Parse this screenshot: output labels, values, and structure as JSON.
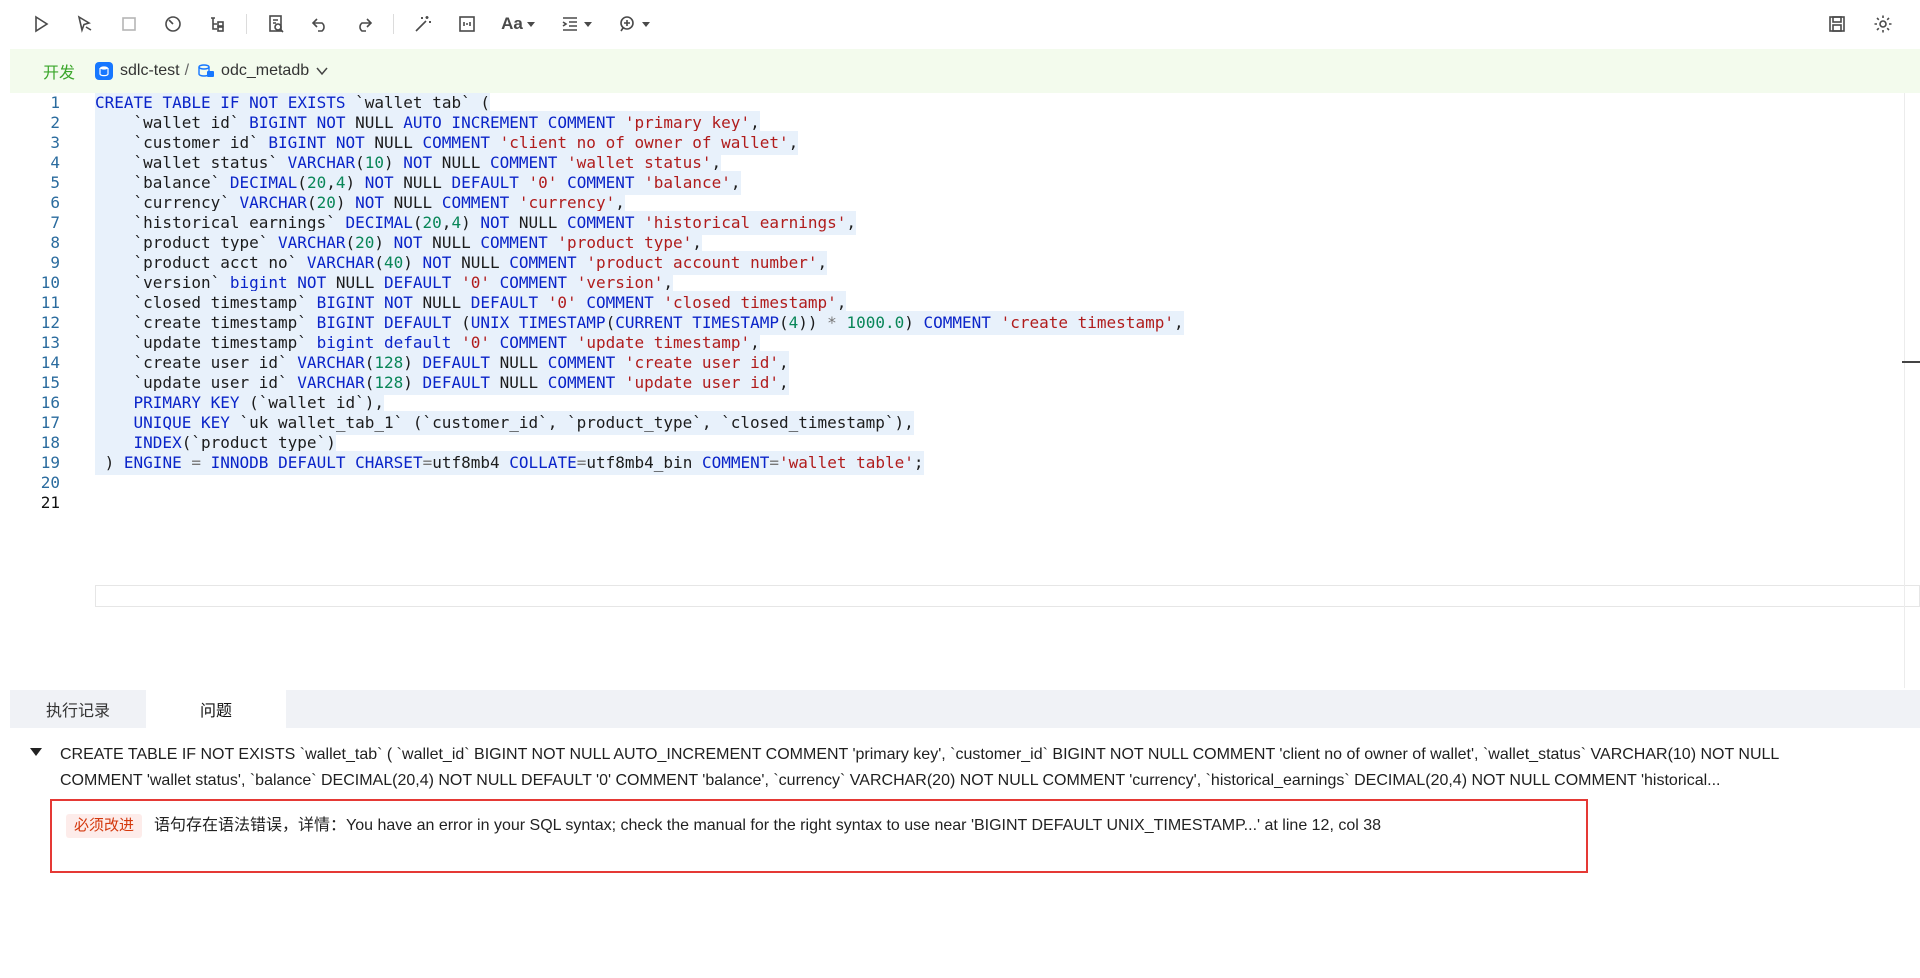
{
  "toolbar": {
    "font_label": "Aa",
    "buttons": [
      "run-icon",
      "run-selection-icon",
      "stop-icon",
      "plan-icon",
      "tree-icon",
      "format-icon",
      "undo-icon",
      "redo-icon",
      "magic-icon",
      "terminal-icon",
      "font-icon",
      "indent-icon",
      "snippet-icon",
      "save-icon",
      "settings-icon"
    ]
  },
  "context": {
    "env": "开发",
    "datasource": "sdlc-test",
    "separator": "/",
    "database": "odc_metadb"
  },
  "editor": {
    "line_numbers": [
      "1",
      "2",
      "3",
      "4",
      "5",
      "6",
      "7",
      "8",
      "9",
      "10",
      "11",
      "12",
      "13",
      "14",
      "15",
      "16",
      "17",
      "18",
      "19",
      "20",
      "21"
    ],
    "current_line": 21,
    "lines": [
      "CREATE TABLE IF NOT EXISTS `wallet_tab` (",
      "    `wallet_id` BIGINT NOT NULL AUTO_INCREMENT COMMENT 'primary key',",
      "    `customer_id` BIGINT NOT NULL COMMENT 'client no of owner of wallet',",
      "    `wallet_status` VARCHAR(10) NOT NULL COMMENT 'wallet status',",
      "    `balance` DECIMAL(20,4) NOT NULL DEFAULT '0' COMMENT 'balance',",
      "    `currency` VARCHAR(20) NOT NULL COMMENT 'currency',",
      "    `historical_earnings` DECIMAL(20,4) NOT NULL COMMENT 'historical earnings',",
      "    `product_type` VARCHAR(20) NOT NULL COMMENT 'product type',",
      "    `product_acct_no` VARCHAR(40) NOT NULL COMMENT 'product account number',",
      "    `version` bigint NOT NULL DEFAULT '0' COMMENT 'version',",
      "    `closed_timestamp` BIGINT NOT NULL DEFAULT '0' COMMENT 'closed timestamp',",
      "    `create_timestamp` BIGINT DEFAULT (UNIX_TIMESTAMP(CURRENT_TIMESTAMP(4)) * 1000.0) COMMENT 'create timestamp',",
      "    `update_timestamp` bigint default '0' COMMENT 'update timestamp',",
      "    `create_user_id` VARCHAR(128) DEFAULT NULL COMMENT 'create user id',",
      "    `update_user_id` VARCHAR(128) DEFAULT NULL COMMENT 'update user id',",
      "    PRIMARY KEY (`wallet_id`),",
      "    UNIQUE KEY `uk_wallet_tab_1` (`customer_id`, `product_type`, `closed_timestamp`),",
      "    INDEX(`product_type`)",
      " ) ENGINE = INNODB DEFAULT CHARSET=utf8mb4 COLLATE=utf8mb4_bin COMMENT='wallet table';",
      "",
      ""
    ]
  },
  "panel": {
    "tabs": [
      {
        "label": "执行记录",
        "active": false
      },
      {
        "label": "问题",
        "active": true
      }
    ],
    "issue_sql_line1": "CREATE TABLE IF NOT EXISTS `wallet_tab` ( `wallet_id` BIGINT NOT NULL AUTO_INCREMENT COMMENT 'primary key', `customer_id` BIGINT NOT NULL COMMENT 'client no of owner of wallet', `wallet_status` VARCHAR(10) NOT NULL",
    "issue_sql_line2": "COMMENT 'wallet status', `balance` DECIMAL(20,4) NOT NULL DEFAULT '0' COMMENT 'balance', `currency` VARCHAR(20) NOT NULL COMMENT 'currency', `historical_earnings` DECIMAL(20,4) NOT NULL COMMENT 'historical...",
    "severity": "必须改进",
    "message": "语句存在语法错误，详情：You have an error in your SQL syntax; check the manual for the right syntax to use near 'BIGINT DEFAULT UNIX_TIMESTAMP...' at line 12, col 38"
  },
  "colors": {
    "keyword": "#0a24c9",
    "string": "#b01c1c",
    "number": "#098658",
    "env_green": "#3aa62a",
    "error_red": "#e53935"
  }
}
